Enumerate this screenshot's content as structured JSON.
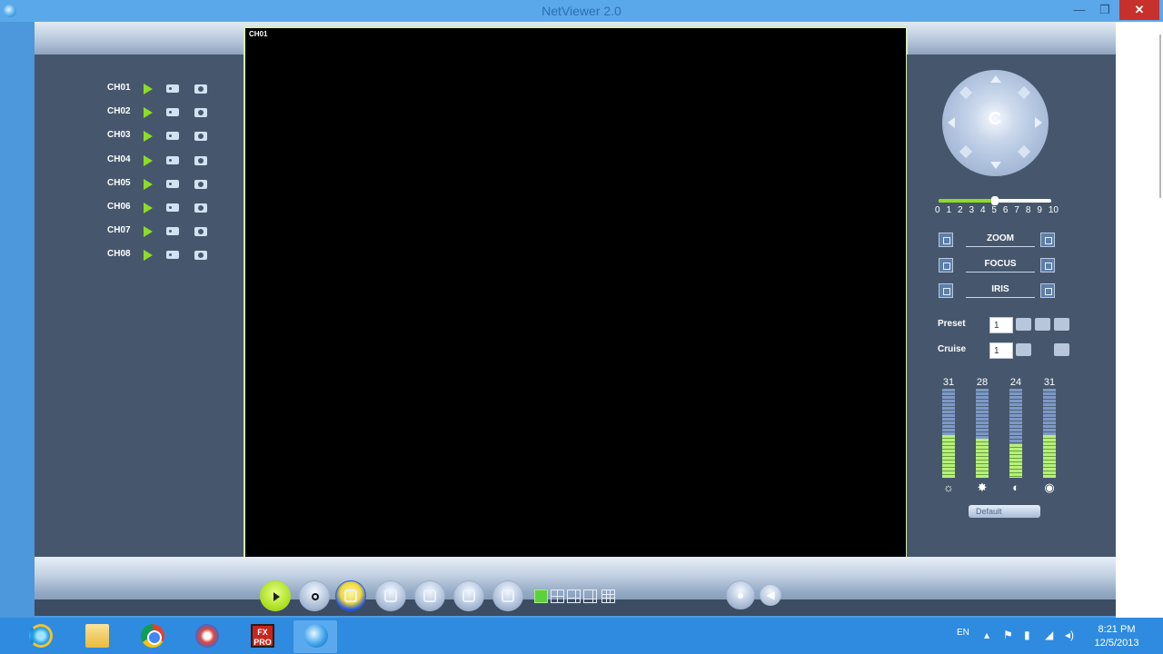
{
  "window": {
    "title": "NetViewer 2.0",
    "min_icon": "minimize-icon",
    "max_icon": "maximize-icon",
    "close_icon": "close-icon",
    "min_glyph": "—",
    "max_glyph": "❐",
    "close_glyph": "✕"
  },
  "channels": [
    {
      "label": "CH01"
    },
    {
      "label": "CH02"
    },
    {
      "label": "CH03"
    },
    {
      "label": "CH04"
    },
    {
      "label": "CH05"
    },
    {
      "label": "CH06"
    },
    {
      "label": "CH07"
    },
    {
      "label": "CH08"
    }
  ],
  "video": {
    "channel_label": "CH01"
  },
  "ptz": {
    "center_glyph": "C",
    "speed": {
      "ticks": [
        "0",
        "1",
        "2",
        "3",
        "4",
        "5",
        "6",
        "7",
        "8",
        "9",
        "10"
      ],
      "value": 5
    },
    "zoom_label": "ZOOM",
    "focus_label": "FOCUS",
    "iris_label": "IRIS",
    "preset_label": "Preset",
    "preset_value": "1",
    "cruise_label": "Cruise",
    "cruise_value": "1"
  },
  "color": {
    "values": [
      {
        "name": "brightness",
        "value": 31,
        "icon": "brightness-icon",
        "glyph": "☼",
        "label": "31"
      },
      {
        "name": "contrast",
        "value": 28,
        "icon": "contrast-icon",
        "glyph": "✸",
        "label": "28"
      },
      {
        "name": "saturation",
        "value": 24,
        "icon": "saturation-icon",
        "glyph": "◐",
        "label": "24"
      },
      {
        "name": "hue",
        "value": 31,
        "icon": "hue-icon",
        "glyph": "◉",
        "label": "31"
      }
    ],
    "max": 64,
    "default_label": "Default"
  },
  "taskbar": {
    "lang": "EN",
    "time": "8:21 PM",
    "date": "12/5/2013",
    "fx_label": "FX\nPRO"
  },
  "colors": {
    "accent_green": "#8edc25",
    "panel": "#46576d",
    "taskbar": "#2f8be0",
    "close_red": "#c7302b"
  }
}
